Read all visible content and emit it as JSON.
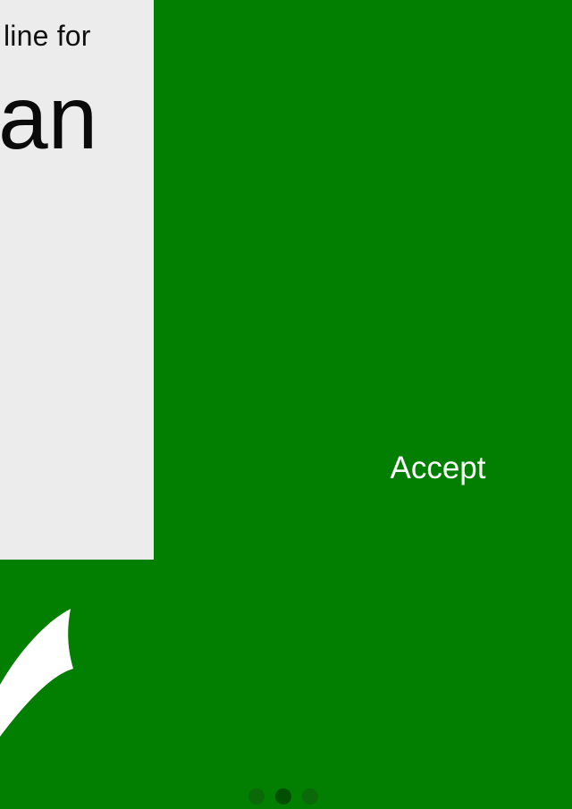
{
  "card": {
    "line_text": "line for",
    "big_text": "an"
  },
  "actions": {
    "accept_label": "Accept"
  },
  "pager": {
    "page_count": 3,
    "active_index": 1
  },
  "colors": {
    "background": "#027e00",
    "card_background": "#ececec",
    "accent_white": "#ffffff",
    "dot_inactive": "#0a6a08",
    "dot_active": "#014f00"
  },
  "icons": {
    "swoosh": "swoosh-icon"
  }
}
